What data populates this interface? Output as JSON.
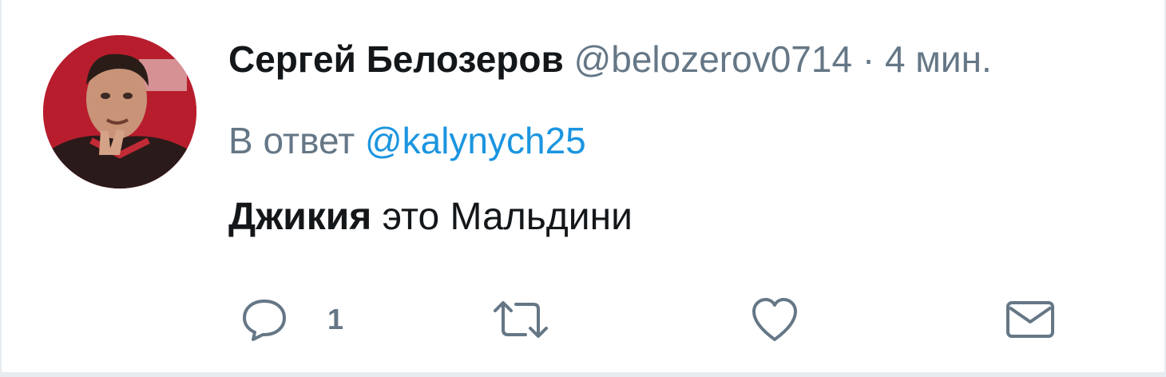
{
  "tweet": {
    "author_name": "Сергей Белозеров",
    "author_handle": "@belozerov0714",
    "separator": "·",
    "timestamp": "4 мин.",
    "reply_prefix": "В ответ",
    "reply_mention": "@kalynych25",
    "text_bold": "Джикия",
    "text_rest": " это Мальдини"
  },
  "actions": {
    "reply_count": "1",
    "icons": [
      "reply-icon",
      "retweet-icon",
      "like-icon",
      "message-icon"
    ]
  },
  "colors": {
    "name": "#14171a",
    "secondary": "#657786",
    "link": "#1b95e0",
    "background": "#e6ecf0"
  }
}
